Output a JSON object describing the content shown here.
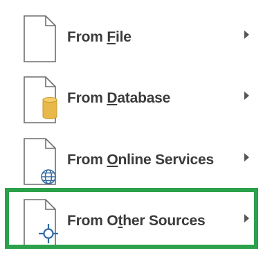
{
  "menu": {
    "items": [
      {
        "label_before": "From ",
        "label_mnemonic": "F",
        "label_after": "ile",
        "icon": "document-icon",
        "submenu": true
      },
      {
        "label_before": "From ",
        "label_mnemonic": "D",
        "label_after": "atabase",
        "icon": "database-document-icon",
        "submenu": true
      },
      {
        "label_before": "From ",
        "label_mnemonic": "O",
        "label_after": "nline Services",
        "icon": "globe-document-icon",
        "submenu": true
      },
      {
        "label_before": "From O",
        "label_mnemonic": "t",
        "label_after": "her Sources",
        "icon": "connector-document-icon",
        "submenu": true,
        "highlighted": true
      }
    ],
    "highlight_color": "#2aa14a",
    "database_color": "#e8b84a",
    "globe_color": "#3a6ea5",
    "connector_color": "#2d6aa8"
  }
}
